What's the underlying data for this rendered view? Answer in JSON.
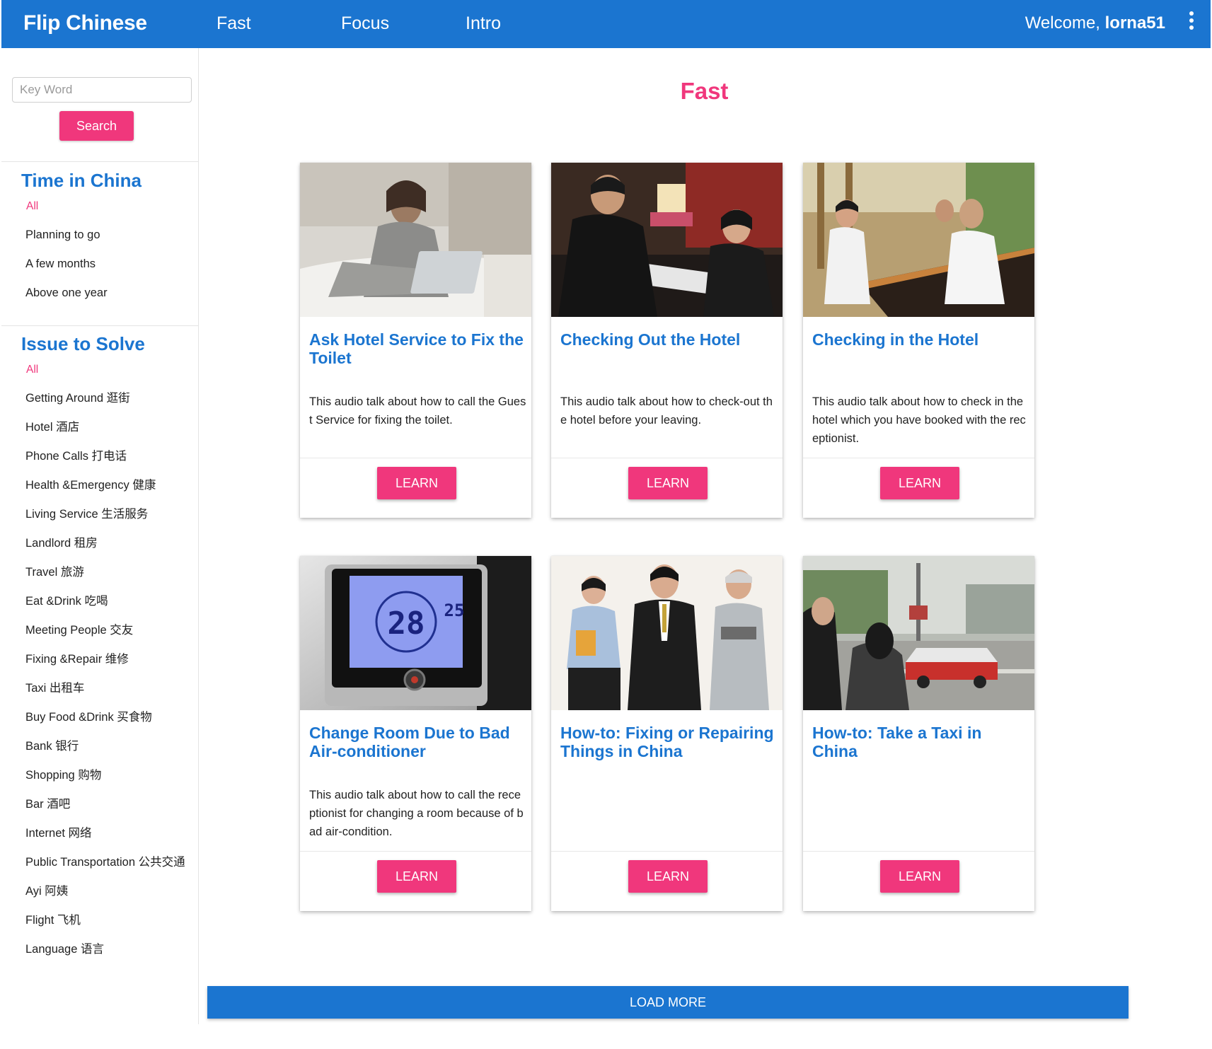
{
  "header": {
    "brand": "Flip Chinese",
    "nav": [
      "Fast",
      "Focus",
      "Intro"
    ],
    "welcome_prefix": "Welcome, ",
    "username": "lorna51",
    "menu_icon": "more-vert-icon"
  },
  "sidebar": {
    "search_placeholder": "Key Word",
    "search_value": "",
    "search_label": "Search",
    "sections": [
      {
        "title": "Time in China",
        "all_label": "All",
        "items": [
          "Planning to go",
          "A few months",
          "Above one year"
        ]
      },
      {
        "title": "Issue to Solve",
        "all_label": "All",
        "items": [
          "Getting Around 逛街",
          "Hotel 酒店",
          "Phone Calls 打电话",
          "Health &Emergency 健康",
          "Living Service 生活服务",
          "Landlord 租房",
          "Travel 旅游",
          "Eat &Drink 吃喝",
          "Meeting People 交友",
          "Fixing &Repair 维修",
          "Taxi 出租车",
          "Buy Food &Drink 买食物",
          "Bank 银行",
          "Shopping 购物",
          "Bar 酒吧",
          "Internet 网络",
          "Public Transportation 公共交通",
          "Ayi 阿姨",
          "Flight 飞机",
          "Language 语言"
        ]
      }
    ]
  },
  "main": {
    "title": "Fast",
    "learn_label": "LEARN",
    "load_more_label": "LOAD MORE",
    "cards": [
      {
        "title": "Ask Hotel Service to Fix the Toilet",
        "description": "This audio talk about how to call the Guest Service for fixing the toilet.",
        "image": "woman-on-phone-in-hotel-bed-photo"
      },
      {
        "title": "Checking Out the Hotel",
        "description": "This audio talk about how to check-out the hotel before your leaving.",
        "image": "hotel-checkout-desk-photo"
      },
      {
        "title": "Checking in the Hotel",
        "description": "This audio talk about how to check in the hotel which you have booked with the receptionist.",
        "image": "hotel-reception-checkin-photo"
      },
      {
        "title": "Change Room Due to Bad Air-conditioner",
        "description": "This audio talk about how to call the receptionist for changing a room because of bad air-condition.",
        "image": "air-conditioner-thermostat-photo",
        "thermostat_reading": "28",
        "thermostat_setpoint": "25"
      },
      {
        "title": "How-to: Fixing or Repairing Things in China",
        "description": "",
        "image": "service-staff-group-photo"
      },
      {
        "title": "How-to: Take a Taxi in China",
        "description": "",
        "image": "taxi-street-photo"
      }
    ]
  }
}
